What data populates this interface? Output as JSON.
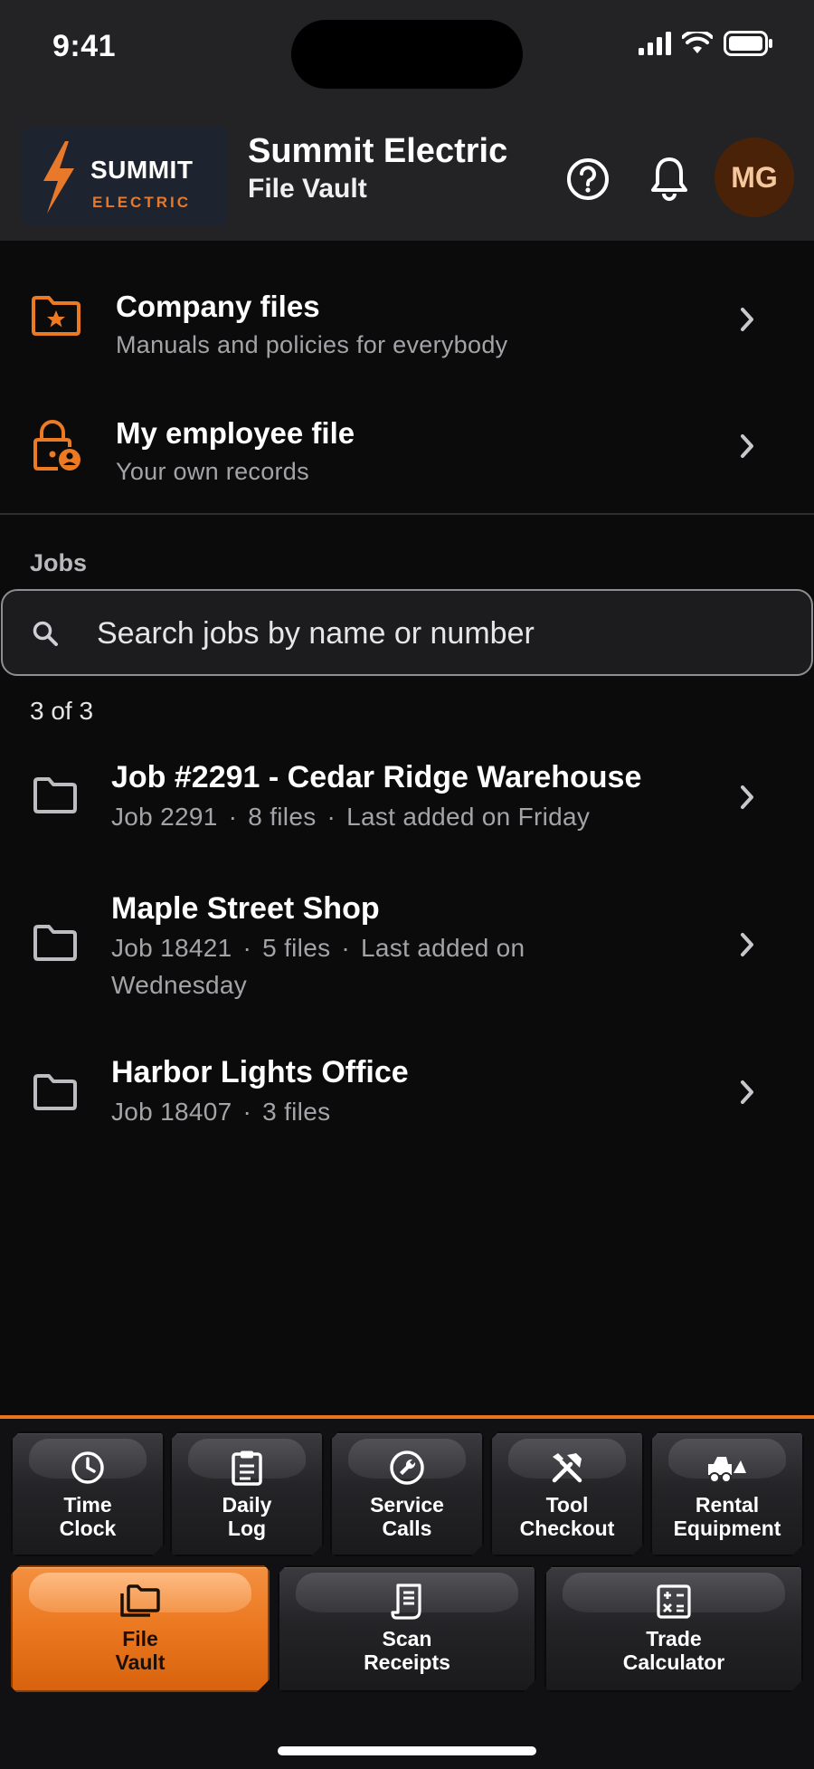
{
  "status_bar": {
    "time": "9:41"
  },
  "header": {
    "logo_word_main": "SUMMIT",
    "logo_word_sub": "ELECTRIC",
    "title": "Summit Electric",
    "subtitle": "File Vault",
    "help_icon": "help-circle-icon",
    "notifications_icon": "bell-icon",
    "avatar_initials": "MG"
  },
  "quick_links": [
    {
      "title": "Company files",
      "subtitle": "Manuals and policies for everybody",
      "icon": "folder-star-icon"
    },
    {
      "title": "My employee file",
      "subtitle": "Your own records",
      "icon": "lock-person-icon"
    }
  ],
  "jobs": {
    "heading": "Jobs",
    "search_placeholder": "Search jobs by name or number",
    "count_label": "3 of 3",
    "items": [
      {
        "title": "Job #2291 - Cedar Ridge Warehouse",
        "job_number": "Job 2291",
        "files": "8 files",
        "last_added": "Last added on Friday"
      },
      {
        "title": "Maple Street Shop",
        "job_number": "Job 18421",
        "files": "5 files",
        "last_added": "Last added on Wednesday"
      },
      {
        "title": "Harbor Lights Office",
        "job_number": "Job 18407",
        "files": "3 files",
        "last_added": ""
      }
    ]
  },
  "dock": {
    "row1": [
      {
        "label": "Time\nClock",
        "icon": "clock-icon"
      },
      {
        "label": "Daily\nLog",
        "icon": "clipboard-icon"
      },
      {
        "label": "Service\nCalls",
        "icon": "wrench-icon"
      },
      {
        "label": "Tool\nCheckout",
        "icon": "tools-icon"
      },
      {
        "label": "Rental\nEquipment",
        "icon": "forklift-icon"
      }
    ],
    "row2": [
      {
        "label": "File\nVault",
        "icon": "folders-icon",
        "active": true
      },
      {
        "label": "Scan\nReceipts",
        "icon": "receipt-icon"
      },
      {
        "label": "Trade\nCalculator",
        "icon": "calculator-icon"
      }
    ]
  },
  "colors": {
    "accent": "#ec7a22",
    "background": "#0b0b0c",
    "header_bg": "#232326",
    "muted_text": "#a4a4a8"
  }
}
